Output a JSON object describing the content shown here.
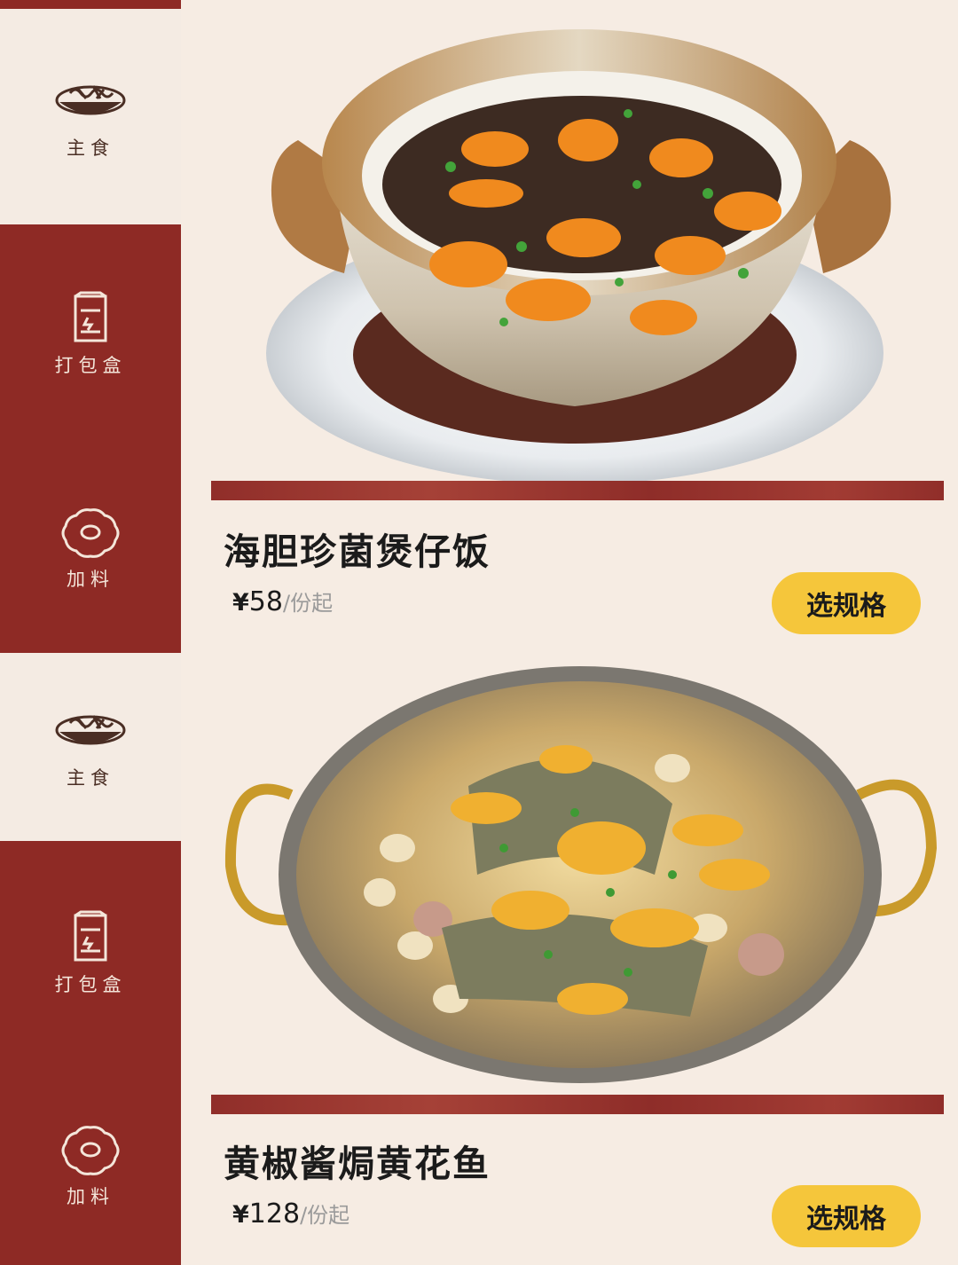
{
  "sidebar": {
    "groups": [
      {
        "items": [
          {
            "label": "主食",
            "icon": "rice-bowl-icon"
          },
          {
            "label": "打包盒",
            "icon": "takeout-box-icon"
          },
          {
            "label": "加料",
            "icon": "topping-ring-icon"
          }
        ]
      },
      {
        "items": [
          {
            "label": "主食",
            "icon": "rice-bowl-icon"
          },
          {
            "label": "打包盒",
            "icon": "takeout-box-icon"
          },
          {
            "label": "加料",
            "icon": "topping-ring-icon"
          }
        ]
      }
    ]
  },
  "dishes": [
    {
      "name": "海胆珍菌煲仔饭",
      "currency": "¥",
      "price": "58",
      "unit": "/份起",
      "button_label": "选规格",
      "image": "claypot-rice-with-sea-urchin-photo"
    },
    {
      "name": "黄椒酱焗黄花鱼",
      "currency": "¥",
      "price": "128",
      "unit": "/份起",
      "button_label": "选规格",
      "image": "yellow-croaker-in-pan-photo"
    }
  ],
  "colors": {
    "sidebar_red": "#8e2a25",
    "sidebar_light": "#f4ebe3",
    "page_bg": "#f6ece3",
    "button_yellow": "#f5c63b"
  }
}
